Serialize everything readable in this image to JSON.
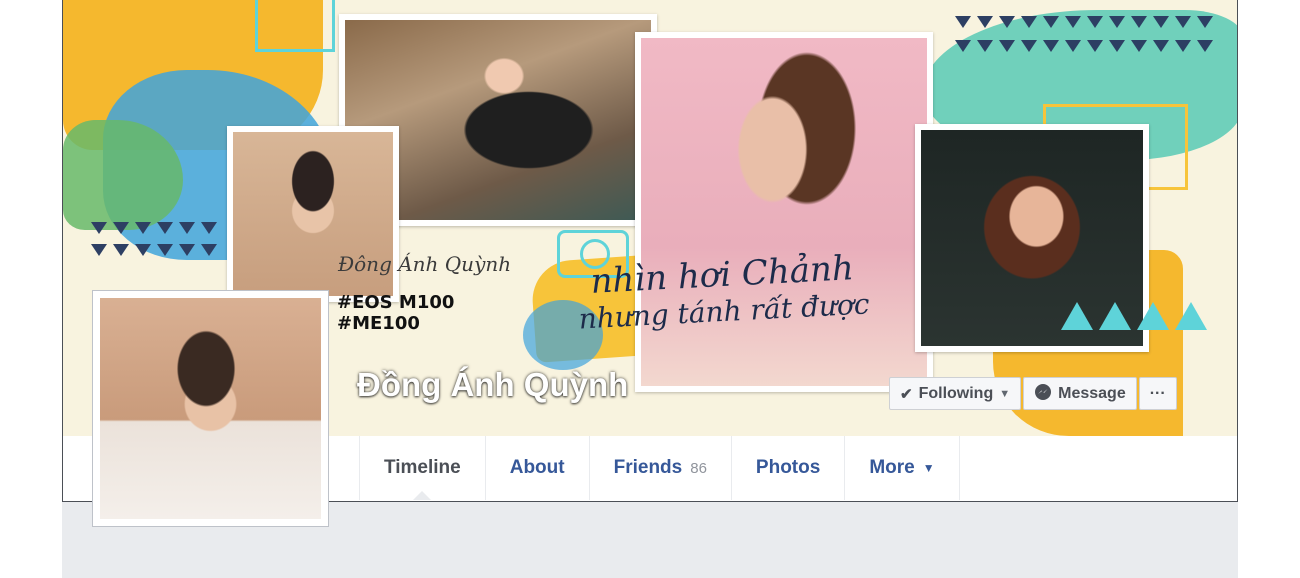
{
  "cover": {
    "brand_text": "Đông Ánh Quỳnh",
    "hashtags": [
      "#EOS M100",
      "#ME100"
    ],
    "banner_line1": "nhìn hơi Chảnh",
    "banner_line2": "nhưng tánh rất được"
  },
  "profile": {
    "name": "Đồng Ánh Quỳnh"
  },
  "actions": {
    "following_label": "Following",
    "message_label": "Message",
    "more_label": "···"
  },
  "nav": {
    "tabs": [
      {
        "label": "Timeline"
      },
      {
        "label": "About"
      },
      {
        "label": "Friends",
        "count": "86"
      },
      {
        "label": "Photos"
      },
      {
        "label": "More"
      }
    ]
  },
  "colors": {
    "link_blue": "#365899",
    "teal": "#5ed3d9",
    "yellow": "#f7c43a",
    "navy": "#2d3f63"
  }
}
